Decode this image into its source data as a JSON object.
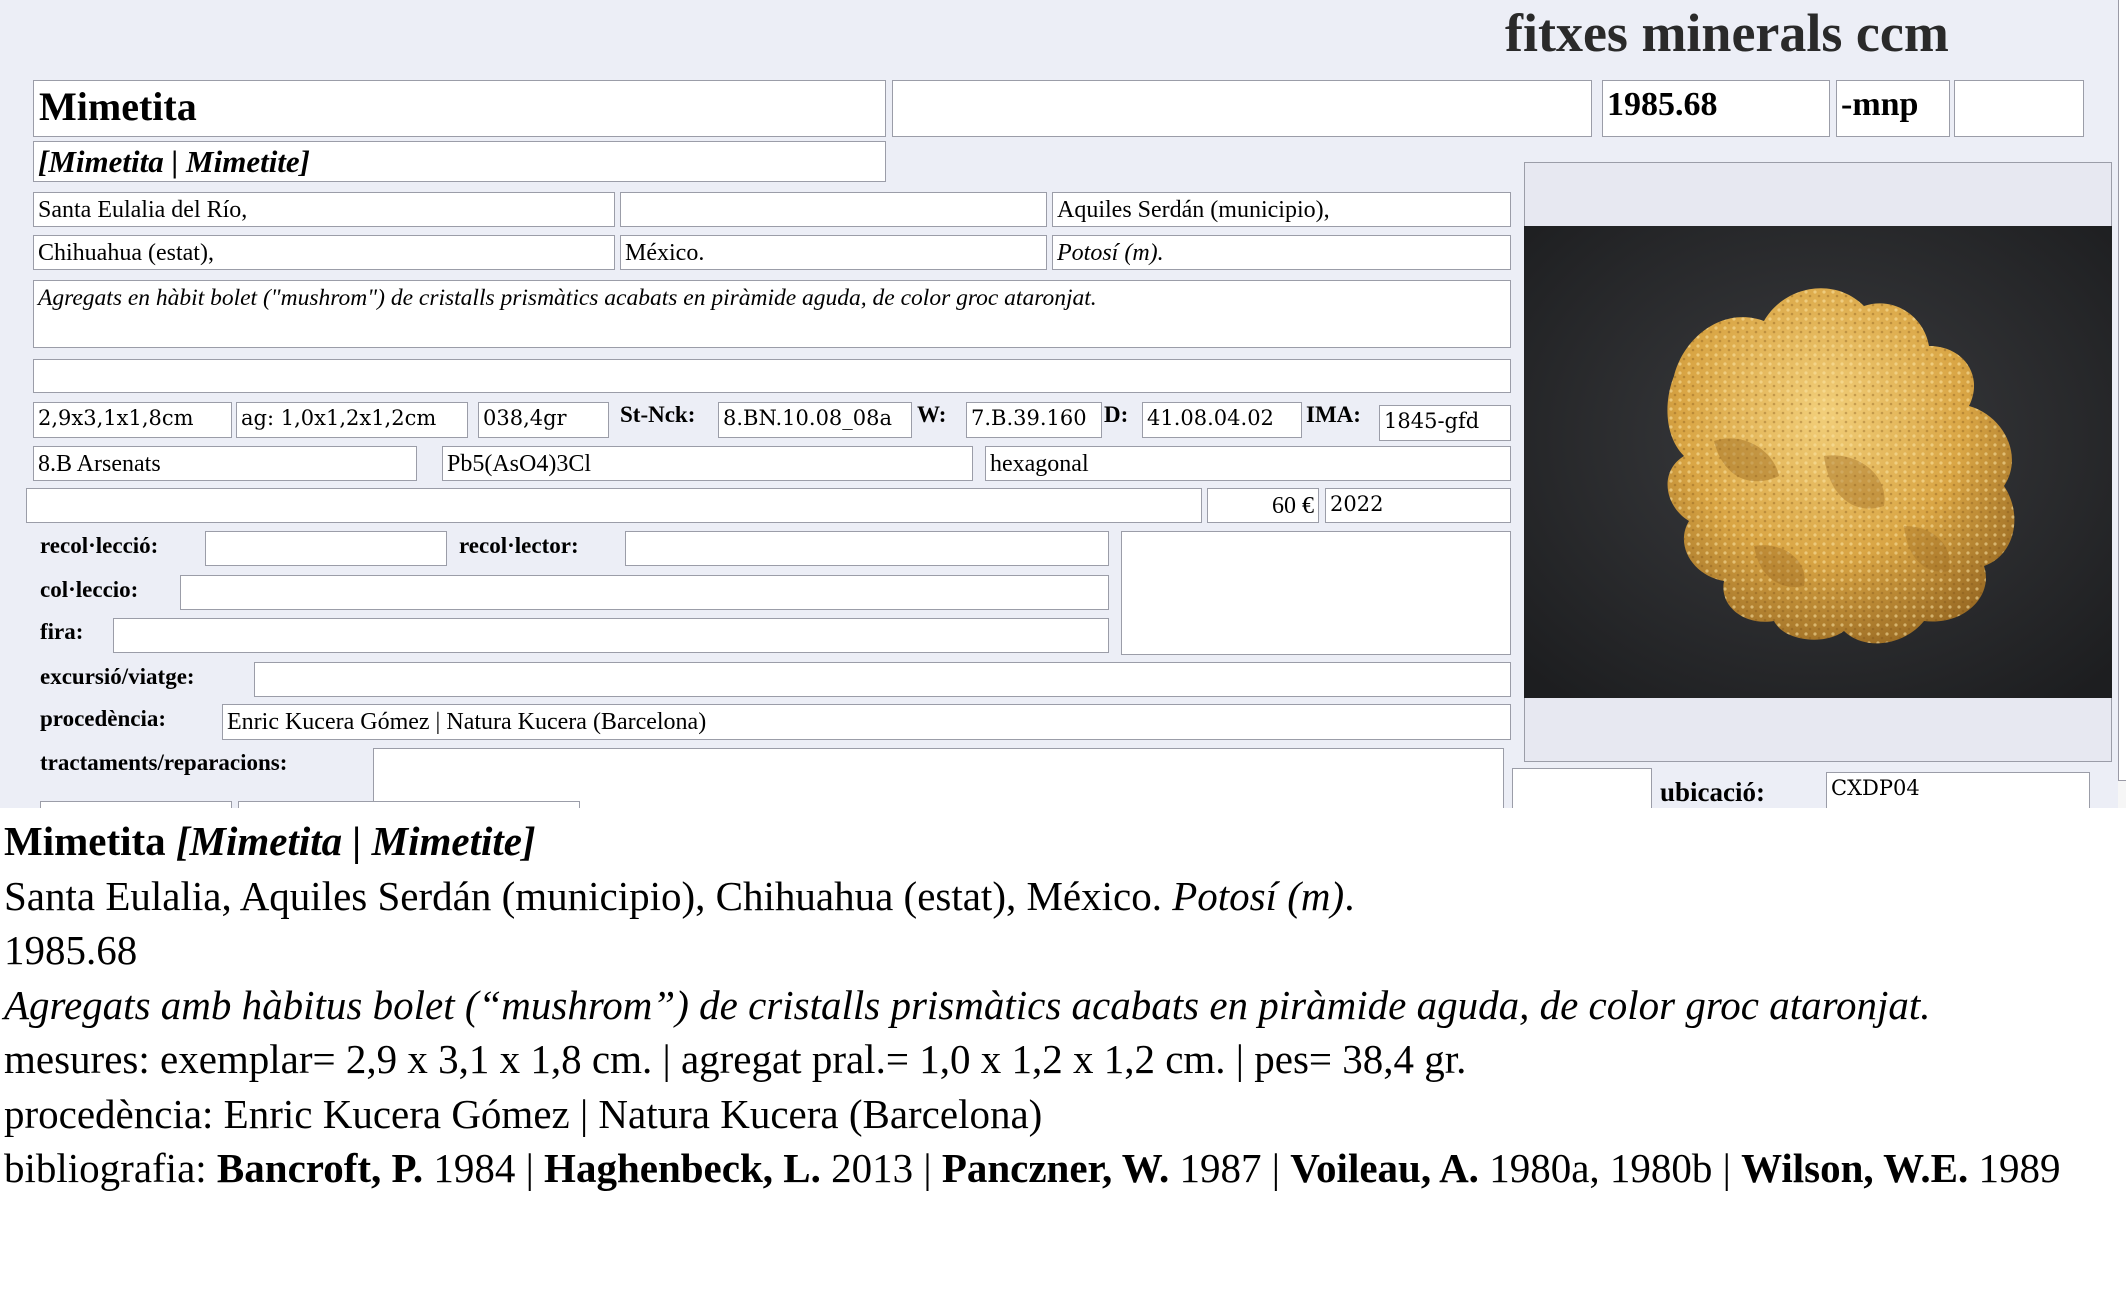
{
  "header": {
    "app_title": "fitxes minerals ccm"
  },
  "record": {
    "name": "Mimetita",
    "field2": "",
    "number": "1985.68",
    "suffix": "-mnp",
    "field5": "",
    "synonyms": "[Mimetita | Mimetite]",
    "locality1": "Santa Eulalia del Río,",
    "locality2": "",
    "locality3": "Aquiles Serdán (municipio),",
    "locality4": "Chihuahua (estat),",
    "locality5": "México.",
    "locality6": "Potosí (m).",
    "description": "Agregats en hàbit bolet (\"mushrom\") de cristalls prismàtics acabats en piràmide aguda, de color groc ataronjat.",
    "notes": "",
    "dimensions": "2,9x3,1x1,8cm",
    "aggregate": "ag: 1,0x1,2x1,2cm",
    "weight": "038,4gr",
    "strunz_label": "St-Nck:",
    "strunz": "8.BN.10.08_08a",
    "w_label": "W:",
    "w": "7.B.39.160",
    "d_label": "D:",
    "d": "41.08.04.02",
    "ima_label": "IMA:",
    "ima": "1845-gfd",
    "class": "8.B Arsenats",
    "formula": "Pb5(AsO4)3Cl",
    "system": "hexagonal",
    "wide_empty": "",
    "price": "60 €",
    "year": "2022",
    "recoleccio_label": "recol·lecció:",
    "recoleccio": "",
    "recolector_label": "recol·lector:",
    "recolector": "",
    "colleccio_label": "col·leccio:",
    "colleccio": "",
    "fira_label": "fira:",
    "fira": "",
    "excursio_label": "excursió/viatge:",
    "excursio": "",
    "procedencia_label": "procedència:",
    "procedencia": "Enric Kucera Gómez | Natura Kucera (Barcelona)",
    "tractaments_label": "tractaments/reparacions:",
    "tractaments": "",
    "side_box": "",
    "ubicacio_small": "",
    "ubicacio_label": "ubicació:",
    "ubicacio": "CXDP04"
  },
  "summary": {
    "name": "Mimetita",
    "synonyms": "[Mimetita | Mimetite]",
    "locality_plain": "Santa Eulalia, Aquiles Serdán (municipio), Chihuahua (estat), México.",
    "locality_italic": "Potosí (m)",
    "locality_end": ".",
    "number": "1985.68",
    "description": "Agregats amb hàbitus bolet (“mushrom”) de cristalls prismàtics acabats en piràmide aguda, de color groc ataronjat.",
    "measures": "mesures: exemplar= 2,9 x 3,1 x 1,8 cm. | agregat pral.= 1,0 x 1,2 x 1,2 cm. | pes= 38,4 gr.",
    "procedencia": "procedència: Enric Kucera Gómez | Natura Kucera (Barcelona)",
    "biblio_label": "bibliografia: ",
    "refs": [
      {
        "author": "Bancroft, P.",
        "year": " 1984 | "
      },
      {
        "author": "Haghenbeck, L.",
        "year": " 2013 | "
      },
      {
        "author": "Panczner, W.",
        "year": " 1987 | "
      },
      {
        "author": "Voileau, A.",
        "year": " 1980a, 1980b | "
      },
      {
        "author": "Wilson, W.E.",
        "year": " 1989"
      }
    ]
  },
  "colors": {
    "form_bg": "#eceef6",
    "field_border": "#9b9da8",
    "photo_bg": "#262729",
    "mineral": "#d9a544"
  }
}
